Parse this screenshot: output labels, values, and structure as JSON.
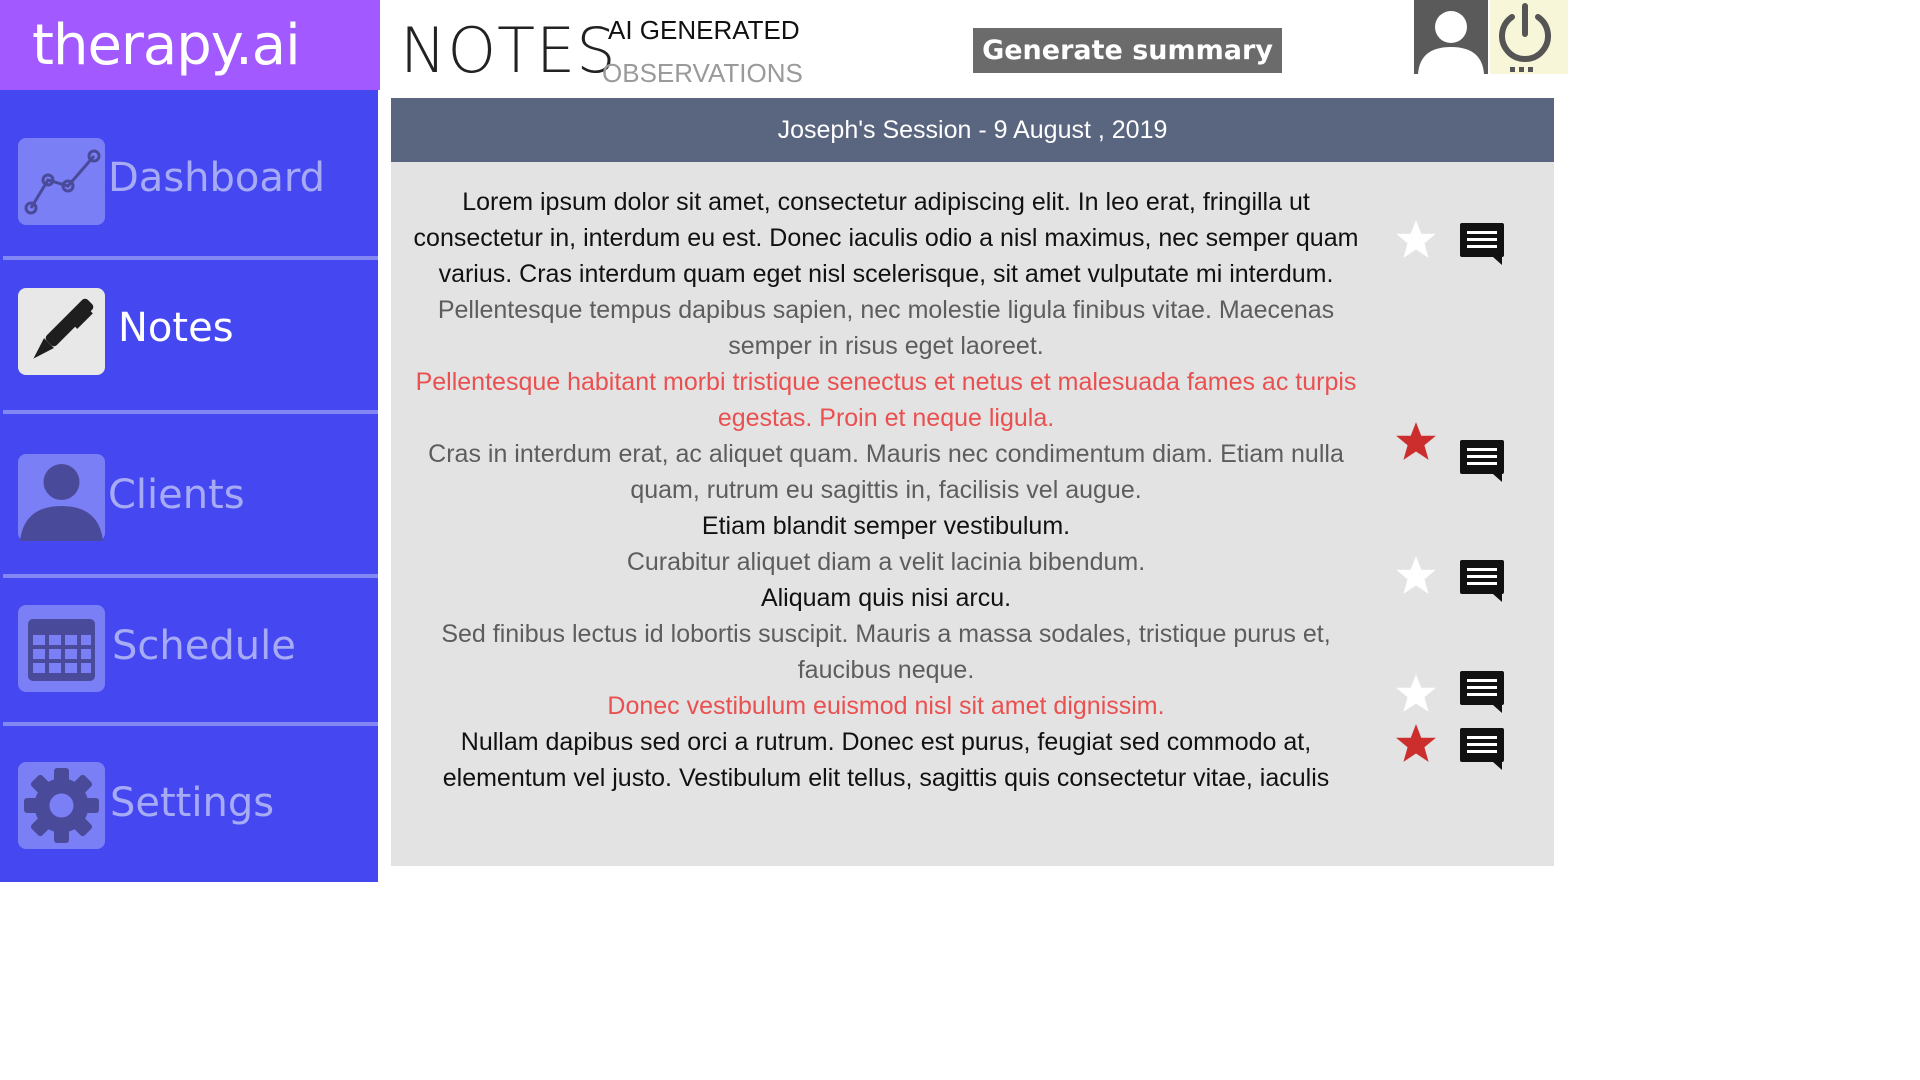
{
  "app": {
    "brand": "therapy.ai"
  },
  "sidebar": {
    "items": [
      {
        "label": "Dashboard",
        "icon": "chart-line-icon",
        "active": false
      },
      {
        "label": "Notes",
        "icon": "pen-icon",
        "active": true
      },
      {
        "label": "Clients",
        "icon": "user-icon",
        "active": false
      },
      {
        "label": "Schedule",
        "icon": "calendar-icon",
        "active": false
      },
      {
        "label": "Settings",
        "icon": "gear-icon",
        "active": false
      }
    ]
  },
  "header": {
    "title": "NOTES",
    "subtitle_line1": "AI GENERATED",
    "subtitle_line2": "OBSERVATIONS",
    "generate_button": "Generate summary",
    "user_icon": "user-avatar-icon",
    "power_icon": "power-icon"
  },
  "session": {
    "title": "Joseph's Session - 9 August , 2019",
    "paragraphs": [
      {
        "text": "Lorem ipsum dolor sit amet, consectetur adipiscing elit. In leo erat, fringilla ut consectetur in, interdum eu est. Donec iaculis odio a nisl maximus, nec semper quam varius. Cras interdum quam eget nisl scelerisque, sit amet vulputate mi interdum.",
        "tone": "black"
      },
      {
        "text": "Pellentesque tempus dapibus sapien, nec molestie ligula finibus vitae. Maecenas semper in risus eget laoreet.",
        "tone": "gray"
      },
      {
        "text": "Pellentesque habitant morbi tristique senectus et netus et malesuada fames ac turpis egestas. Proin et neque ligula.",
        "tone": "red"
      },
      {
        "text": "Cras in interdum erat, ac aliquet quam. Mauris nec condimentum diam. Etiam nulla quam, rutrum eu sagittis in, facilisis vel augue.",
        "tone": "gray"
      },
      {
        "text": "Etiam blandit semper vestibulum.",
        "tone": "black"
      },
      {
        "text": "Curabitur aliquet diam a velit lacinia bibendum.",
        "tone": "gray"
      },
      {
        "text": "Aliquam quis nisi arcu.",
        "tone": "black"
      },
      {
        "text": "Sed finibus lectus id lobortis suscipit. Mauris a massa sodales, tristique purus et, faucibus neque.",
        "tone": "gray"
      },
      {
        "text": "Donec vestibulum euismod nisl sit amet dignissim.",
        "tone": "red"
      },
      {
        "text": "Nullam dapibus sed orci a rutrum. Donec est purus, feugiat sed commodo at, elementum vel justo. Vestibulum elit tellus, sagittis quis consectetur vitae, iaculis",
        "tone": "black"
      }
    ],
    "markers": [
      {
        "starred": false
      },
      {
        "starred": true
      },
      {
        "starred": false
      },
      {
        "starred": false
      },
      {
        "starred": true
      }
    ]
  },
  "colors": {
    "brand": "#a259ff",
    "sidebar": "#4548f0",
    "panel_header": "#5a6680",
    "panel_bg": "#e3e3e3",
    "highlight_red": "#ea5050",
    "star_active": "#cc2e2e",
    "star_inactive": "#ffffff"
  }
}
